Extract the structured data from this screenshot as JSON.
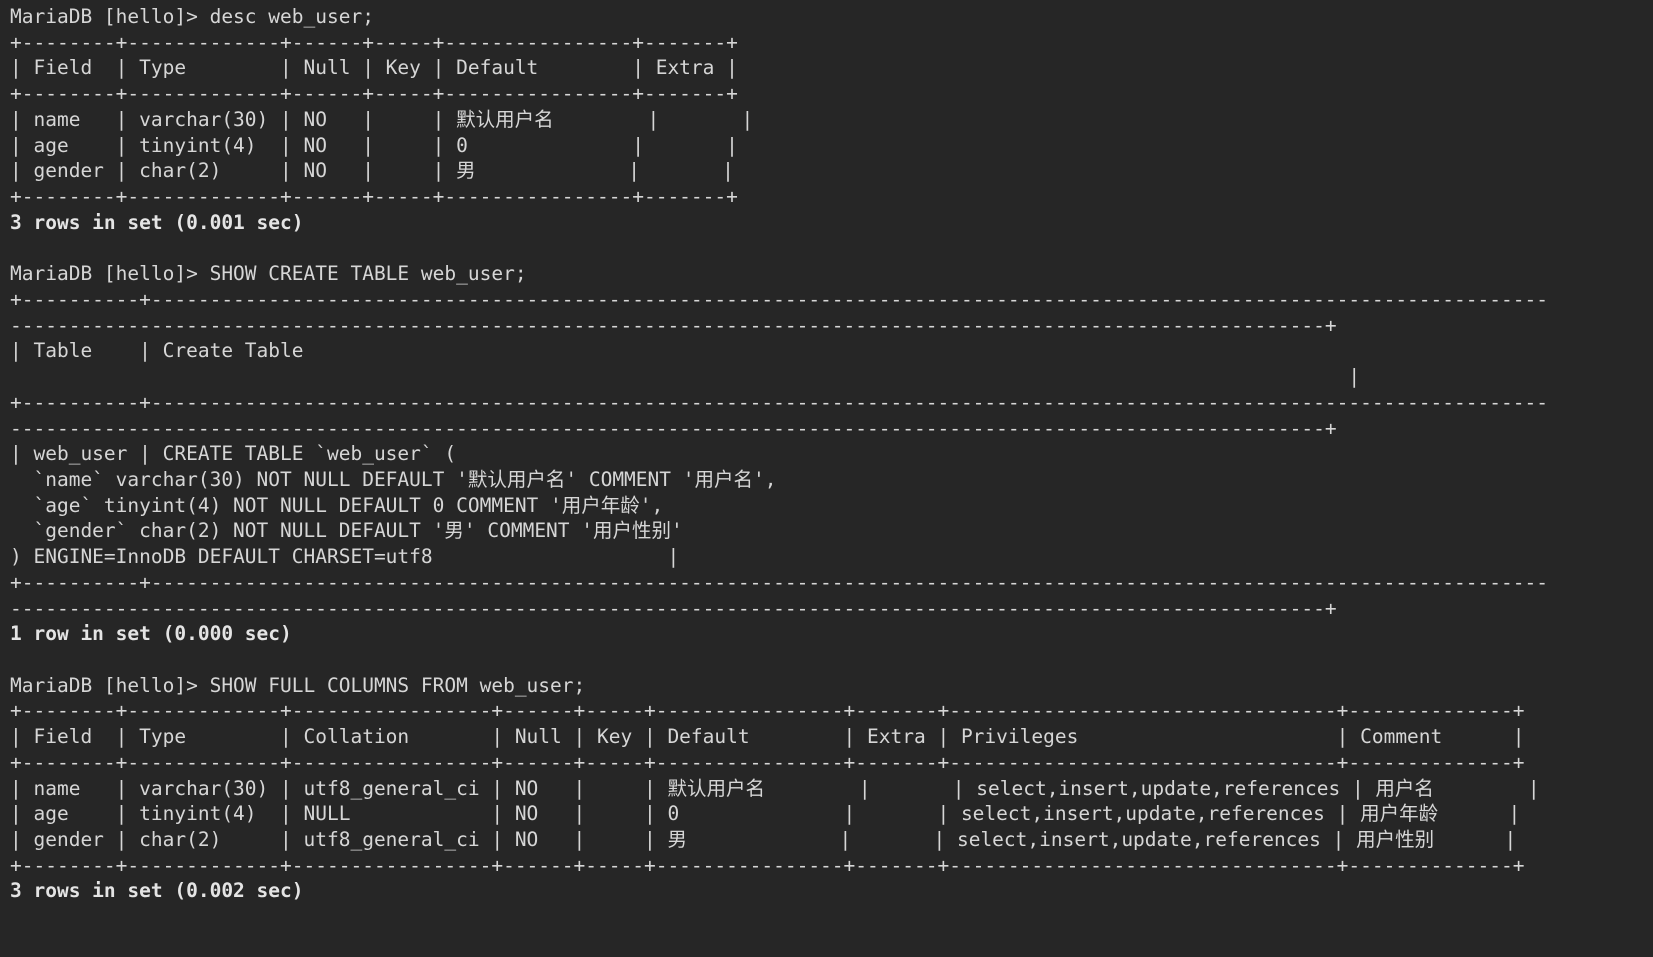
{
  "terminal": {
    "title": "MariaDB client session",
    "colors": {
      "background": "#262626",
      "foreground": "#d6d6d6",
      "bold_foreground": "#e4e4e4"
    },
    "prompt": "MariaDB [hello]>",
    "database": "hello",
    "table_name": "web_user",
    "commands": [
      "desc web_user;",
      "SHOW CREATE TABLE web_user;",
      "SHOW FULL COLUMNS FROM web_user;"
    ],
    "lines": [
      {
        "id": "l01",
        "bold": false,
        "text": "MariaDB [hello]> desc web_user;"
      },
      {
        "id": "l02",
        "bold": false,
        "text": "+--------+-------------+------+-----+----------------+-------+"
      },
      {
        "id": "l03",
        "bold": false,
        "text": "| Field  | Type        | Null | Key | Default        | Extra |"
      },
      {
        "id": "l04",
        "bold": false,
        "text": "+--------+-------------+------+-----+----------------+-------+"
      },
      {
        "id": "l05",
        "bold": false,
        "text": "| name   | varchar(30) | NO   |     | 默认用户名        |       |"
      },
      {
        "id": "l06",
        "bold": false,
        "text": "| age    | tinyint(4)  | NO   |     | 0              |       |"
      },
      {
        "id": "l07",
        "bold": false,
        "text": "| gender | char(2)     | NO   |     | 男             |       |"
      },
      {
        "id": "l08",
        "bold": false,
        "text": "+--------+-------------+------+-----+----------------+-------+"
      },
      {
        "id": "l09",
        "bold": true,
        "text": "3 rows in set (0.001 sec)"
      },
      {
        "id": "l10",
        "bold": false,
        "text": ""
      },
      {
        "id": "l11",
        "bold": false,
        "text": "MariaDB [hello]> SHOW CREATE TABLE web_user;"
      },
      {
        "id": "l12",
        "bold": false,
        "text": "+----------+-----------------------------------------------------------------------------------------------------------------------"
      },
      {
        "id": "l13",
        "bold": false,
        "text": "----------------------------------------------------------------------------------------------------------------+"
      },
      {
        "id": "l14",
        "bold": false,
        "text": "| Table    | Create Table"
      },
      {
        "id": "l15",
        "bold": false,
        "text": "                                                                                                                  |"
      },
      {
        "id": "l16",
        "bold": false,
        "text": "+----------+-----------------------------------------------------------------------------------------------------------------------"
      },
      {
        "id": "l17",
        "bold": false,
        "text": "----------------------------------------------------------------------------------------------------------------+"
      },
      {
        "id": "l18",
        "bold": false,
        "text": "| web_user | CREATE TABLE `web_user` ("
      },
      {
        "id": "l19",
        "bold": false,
        "text": "  `name` varchar(30) NOT NULL DEFAULT '默认用户名' COMMENT '用户名',"
      },
      {
        "id": "l20",
        "bold": false,
        "text": "  `age` tinyint(4) NOT NULL DEFAULT 0 COMMENT '用户年龄',"
      },
      {
        "id": "l21",
        "bold": false,
        "text": "  `gender` char(2) NOT NULL DEFAULT '男' COMMENT '用户性别'"
      },
      {
        "id": "l22",
        "bold": false,
        "text": ") ENGINE=InnoDB DEFAULT CHARSET=utf8                    |"
      },
      {
        "id": "l23",
        "bold": false,
        "text": "+----------+-----------------------------------------------------------------------------------------------------------------------"
      },
      {
        "id": "l24",
        "bold": false,
        "text": "----------------------------------------------------------------------------------------------------------------+"
      },
      {
        "id": "l25",
        "bold": true,
        "text": "1 row in set (0.000 sec)"
      },
      {
        "id": "l26",
        "bold": false,
        "text": ""
      },
      {
        "id": "l27",
        "bold": false,
        "text": "MariaDB [hello]> SHOW FULL COLUMNS FROM web_user;"
      },
      {
        "id": "l28",
        "bold": false,
        "text": "+--------+-------------+-----------------+------+-----+----------------+-------+---------------------------------+--------------+"
      },
      {
        "id": "l29",
        "bold": false,
        "text": "| Field  | Type        | Collation       | Null | Key | Default        | Extra | Privileges                      | Comment      |"
      },
      {
        "id": "l30",
        "bold": false,
        "text": "+--------+-------------+-----------------+------+-----+----------------+-------+---------------------------------+--------------+"
      },
      {
        "id": "l31",
        "bold": false,
        "text": "| name   | varchar(30) | utf8_general_ci | NO   |     | 默认用户名        |       | select,insert,update,references | 用户名        |"
      },
      {
        "id": "l32",
        "bold": false,
        "text": "| age    | tinyint(4)  | NULL            | NO   |     | 0              |       | select,insert,update,references | 用户年龄      |"
      },
      {
        "id": "l33",
        "bold": false,
        "text": "| gender | char(2)     | utf8_general_ci | NO   |     | 男             |       | select,insert,update,references | 用户性别      |"
      },
      {
        "id": "l34",
        "bold": false,
        "text": "+--------+-------------+-----------------+------+-----+----------------+-------+---------------------------------+--------------+"
      },
      {
        "id": "l35",
        "bold": true,
        "text": "3 rows in set (0.002 sec)"
      }
    ],
    "desc_table": {
      "headers": [
        "Field",
        "Type",
        "Null",
        "Key",
        "Default",
        "Extra"
      ],
      "rows": [
        [
          "name",
          "varchar(30)",
          "NO",
          "",
          "默认用户名",
          ""
        ],
        [
          "age",
          "tinyint(4)",
          "NO",
          "",
          "0",
          ""
        ],
        [
          "gender",
          "char(2)",
          "NO",
          "",
          "男",
          ""
        ]
      ],
      "result": "3 rows in set (0.001 sec)"
    },
    "show_create_table": {
      "headers": [
        "Table",
        "Create Table"
      ],
      "table": "web_user",
      "create_statement": "CREATE TABLE `web_user` (\n  `name` varchar(30) NOT NULL DEFAULT '默认用户名' COMMENT '用户名',\n  `age` tinyint(4) NOT NULL DEFAULT 0 COMMENT '用户年龄',\n  `gender` char(2) NOT NULL DEFAULT '男' COMMENT '用户性别'\n) ENGINE=InnoDB DEFAULT CHARSET=utf8",
      "result": "1 row in set (0.000 sec)"
    },
    "show_full_columns": {
      "headers": [
        "Field",
        "Type",
        "Collation",
        "Null",
        "Key",
        "Default",
        "Extra",
        "Privileges",
        "Comment"
      ],
      "rows": [
        [
          "name",
          "varchar(30)",
          "utf8_general_ci",
          "NO",
          "",
          "默认用户名",
          "",
          "select,insert,update,references",
          "用户名"
        ],
        [
          "age",
          "tinyint(4)",
          "NULL",
          "NO",
          "",
          "0",
          "",
          "select,insert,update,references",
          "用户年龄"
        ],
        [
          "gender",
          "char(2)",
          "utf8_general_ci",
          "NO",
          "",
          "男",
          "",
          "select,insert,update,references",
          "用户性别"
        ]
      ],
      "result": "3 rows in set (0.002 sec)"
    }
  }
}
